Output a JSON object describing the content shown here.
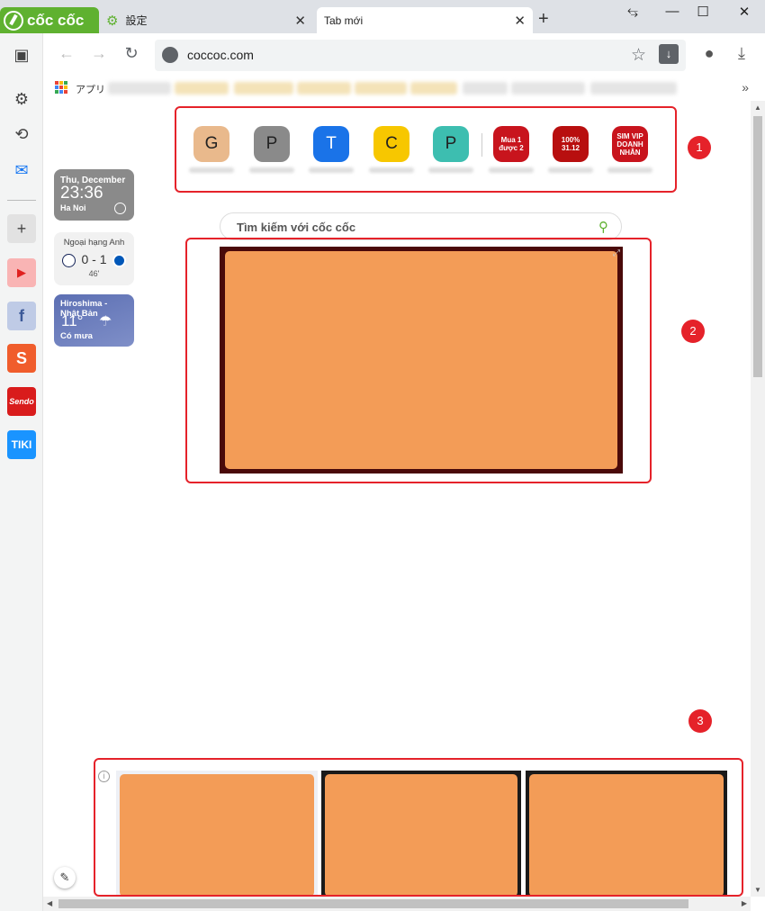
{
  "browser": {
    "logo_text": "cốc cốc",
    "tabs": [
      {
        "label": "設定",
        "icon": "gear-icon"
      },
      {
        "label": "Tab mới",
        "icon": "none"
      }
    ],
    "close_glyph": "✕",
    "new_tab_glyph": "+",
    "window_controls": [
      "⥃",
      "—",
      "☐",
      "✕"
    ]
  },
  "toolbar": {
    "back_glyph": "←",
    "forward_glyph": "→",
    "reload_glyph": "↻",
    "url": "coccoc.com",
    "star_glyph": "☆",
    "ext_glyph": "↓",
    "profile_glyph": "●",
    "download_glyph": "⤓"
  },
  "bookmarks": {
    "apps_label": "アプリ",
    "more_glyph": "»"
  },
  "sidebar": {
    "items": [
      {
        "glyph": "▣",
        "name": "panel-toggle-icon"
      },
      {
        "glyph": "⚙",
        "name": "settings-icon"
      },
      {
        "glyph": "⟲",
        "name": "history-icon"
      },
      {
        "glyph": "✉",
        "name": "messenger-icon"
      },
      {
        "glyph": "+",
        "name": "add-icon"
      },
      {
        "glyph": "▶",
        "name": "youtube-icon"
      },
      {
        "glyph": "f",
        "name": "facebook-icon"
      },
      {
        "glyph": "S",
        "name": "shopee-icon"
      },
      {
        "glyph": "Sendo",
        "name": "sendo-icon"
      },
      {
        "glyph": "TIKI",
        "name": "tiki-icon"
      }
    ],
    "colors": {
      "youtube": "#f24a4a",
      "facebook": "#3b5998",
      "shopee": "#f05d2c",
      "sendo": "#d91c1c",
      "tiki": "#1a94ff"
    }
  },
  "widgets": {
    "clock": {
      "date": "Thu, December",
      "time": "23:36",
      "city": "Ha Noi"
    },
    "sport": {
      "league": "Ngoại hạng Anh",
      "score": "0 - 1",
      "minute": "46'"
    },
    "weather": {
      "location": "Hiroshima - Nhật Bản",
      "temp": "11°",
      "condition": "Có mưa"
    }
  },
  "speed_dial": {
    "items": [
      {
        "letter": "G",
        "color": "#e9b98c"
      },
      {
        "letter": "P",
        "color": "#8a8a8a"
      },
      {
        "letter": "T",
        "color": "#1a73e8"
      },
      {
        "letter": "C",
        "color": "#f7c700"
      },
      {
        "letter": "P",
        "color": "#3dbeb0"
      }
    ],
    "promos": [
      {
        "text": "Mua 1 được 2",
        "color": "#c8141d"
      },
      {
        "text": "100% 31.12",
        "color": "#b80f0f"
      },
      {
        "text": "SIM VIP DOANH NHÂN",
        "color": "#c8141d"
      }
    ]
  },
  "search": {
    "placeholder": "Tìm kiếm với cốc cốc",
    "icon_glyph": "⚲"
  },
  "banner": {
    "close_glyph": "⤢"
  },
  "ads": {
    "info_glyph": "i"
  },
  "annotations": [
    "1",
    "2",
    "3"
  ],
  "edit_glyph": "✎",
  "accent_color": "#5fb130",
  "annotation_color": "#e5222a"
}
